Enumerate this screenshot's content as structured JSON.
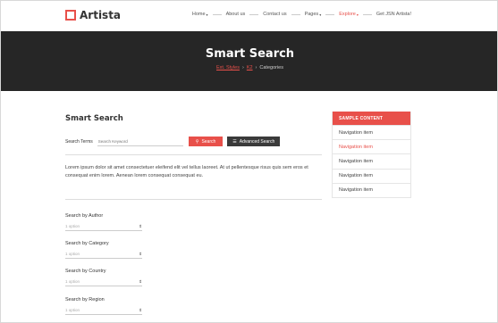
{
  "logo": {
    "text": "Artista"
  },
  "nav": {
    "items": [
      {
        "label": "Home",
        "caret": "▾",
        "active": false
      },
      {
        "label": "About us",
        "caret": "",
        "active": false
      },
      {
        "label": "Contact us",
        "caret": "",
        "active": false
      },
      {
        "label": "Pages",
        "caret": "▾",
        "active": false
      },
      {
        "label": "Explore",
        "caret": "▾",
        "active": true
      },
      {
        "label": "Get JSN Artista!",
        "caret": "",
        "active": false
      }
    ]
  },
  "hero": {
    "title": "Smart Search",
    "breadcrumb": {
      "link": "Ext. Styles",
      "middle": "K2",
      "current": "Categories",
      "sep": "›"
    }
  },
  "main": {
    "heading": "Smart Search",
    "search_label": "Search Terms",
    "search_placeholder": "Search Keyword",
    "search_button": "Search",
    "search_icon": "search-icon",
    "advanced_button": "Advanced Search",
    "advanced_icon": "list-icon",
    "intro_text": "Lorem ipsum dolor sit amet consectetuer eleifend elit vel tellus laoreet. At ut pellentesque risus quis sem eros et consequat enim lorem. Aenean lorem consequat consequat eu."
  },
  "filters": [
    {
      "label": "Search by Author",
      "value": "1 option"
    },
    {
      "label": "Search by Category",
      "value": "1 option"
    },
    {
      "label": "Search by Country",
      "value": "1 option"
    },
    {
      "label": "Search by Region",
      "value": "1 option"
    }
  ],
  "sidebar": {
    "title": "SAMPLE CONTENT",
    "items": [
      {
        "label": "Navigation item",
        "active": false
      },
      {
        "label": "Navigation item",
        "active": true
      },
      {
        "label": "Navigation item",
        "active": false
      },
      {
        "label": "Navigation item",
        "active": false
      },
      {
        "label": "Navigation item",
        "active": false
      }
    ]
  },
  "colors": {
    "accent": "#e8504a",
    "hero_bg": "#262626",
    "dark_button": "#3a3a3a"
  }
}
